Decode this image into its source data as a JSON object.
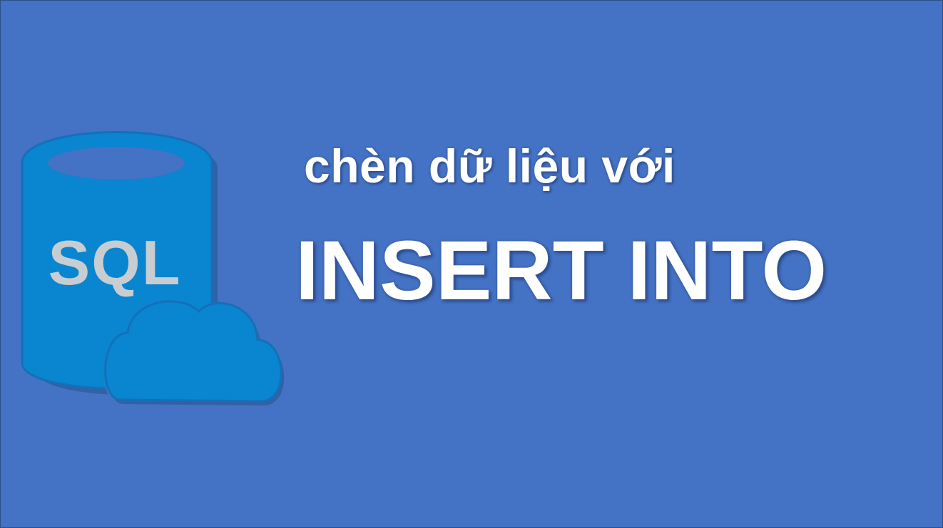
{
  "colors": {
    "background": "#4472c4",
    "cylinder_fill": "#0a85cf",
    "cylinder_outline": "#1470b9",
    "cylinder_shadow": "#315b9c",
    "sql_text": "#c8cdd1",
    "title_text": "#ffffff"
  },
  "logo": {
    "label": "SQL",
    "icon": "sql-database-cloud-icon"
  },
  "title": {
    "subtitle": "chèn dữ liệu với",
    "headline": "INSERT INTO"
  }
}
